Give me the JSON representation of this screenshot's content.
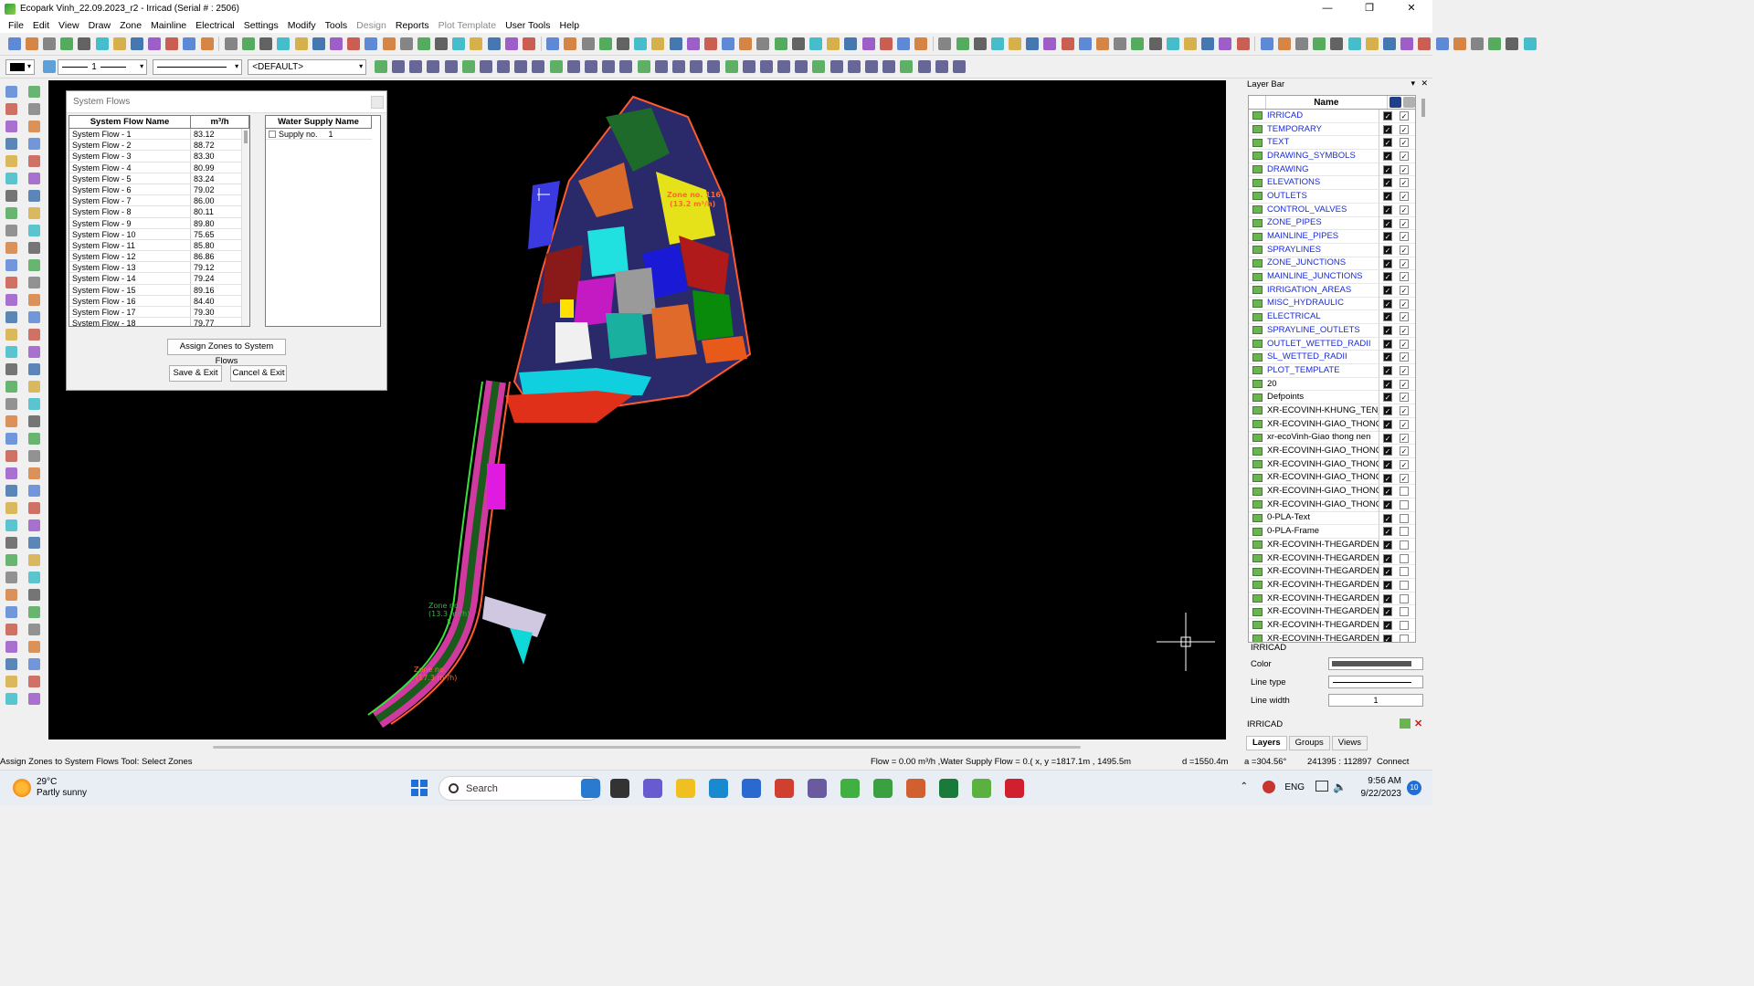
{
  "window": {
    "title": "Ecopark Vinh_22.09.2023_r2 - Irricad (Serial # : 2506)",
    "controls": [
      "—",
      "❐",
      "✕"
    ]
  },
  "menu": [
    {
      "label": "File",
      "enabled": true
    },
    {
      "label": "Edit",
      "enabled": true
    },
    {
      "label": "View",
      "enabled": true
    },
    {
      "label": "Draw",
      "enabled": true
    },
    {
      "label": "Zone",
      "enabled": true
    },
    {
      "label": "Mainline",
      "enabled": true
    },
    {
      "label": "Electrical",
      "enabled": true
    },
    {
      "label": "Settings",
      "enabled": true
    },
    {
      "label": "Modify",
      "enabled": true
    },
    {
      "label": "Tools",
      "enabled": true
    },
    {
      "label": "Design",
      "enabled": false
    },
    {
      "label": "Reports",
      "enabled": true
    },
    {
      "label": "Plot Template",
      "enabled": false
    },
    {
      "label": "User Tools",
      "enabled": true
    },
    {
      "label": "Help",
      "enabled": true
    }
  ],
  "toolbar2": {
    "line_width_value": "1",
    "linetype_value": "",
    "style_value": "<DEFAULT>"
  },
  "dialog": {
    "title": "System Flows",
    "col_name": "System Flow Name",
    "col_flow": "m³/h",
    "col_supply": "Water Supply Name",
    "flows": [
      {
        "name": "System Flow - 1",
        "value": "83.12"
      },
      {
        "name": "System Flow - 2",
        "value": "88.72"
      },
      {
        "name": "System Flow - 3",
        "value": "83.30"
      },
      {
        "name": "System Flow - 4",
        "value": "80.99"
      },
      {
        "name": "System Flow - 5",
        "value": "83.24"
      },
      {
        "name": "System Flow - 6",
        "value": "79.02"
      },
      {
        "name": "System Flow - 7",
        "value": "86.00"
      },
      {
        "name": "System Flow - 8",
        "value": "80.11"
      },
      {
        "name": "System Flow - 9",
        "value": "89.80"
      },
      {
        "name": "System Flow - 10",
        "value": "75.65"
      },
      {
        "name": "System Flow - 11",
        "value": "85.80"
      },
      {
        "name": "System Flow - 12",
        "value": "86.86"
      },
      {
        "name": "System Flow - 13",
        "value": "79.12"
      },
      {
        "name": "System Flow - 14",
        "value": "79.24"
      },
      {
        "name": "System Flow - 15",
        "value": "89.16"
      },
      {
        "name": "System Flow - 16",
        "value": "84.40"
      },
      {
        "name": "System Flow - 17",
        "value": "79.30"
      },
      {
        "name": "System Flow - 18",
        "value": "79.77"
      }
    ],
    "supply": {
      "name": "Supply no.",
      "number": "1"
    },
    "assign_button": "Assign Zones to System Flows",
    "save_button": "Save & Exit",
    "cancel_button": "Cancel & Exit"
  },
  "canvas": {
    "labels": [
      {
        "text": "Zone no. 116",
        "color": "#ff6a2a"
      },
      {
        "text": "(13.2 m³/h)",
        "color": "#ff6a2a"
      },
      {
        "text": "Zone no.",
        "color": "#3fae4a"
      },
      {
        "text": "(13.3 m³/h)",
        "color": "#3fae4a"
      },
      {
        "text": "5",
        "color": "#3fae4a"
      },
      {
        "text": "Zone no.",
        "color": "#ff6a2a"
      },
      {
        "text": "(17.3 m³/h)",
        "color": "#ff6a2a"
      }
    ]
  },
  "layerbar": {
    "title": "Layer Bar",
    "col_name": "Name",
    "layers": [
      {
        "name": "IRRICAD",
        "blue": true,
        "visible": true,
        "printable": true
      },
      {
        "name": "TEMPORARY",
        "blue": true,
        "visible": true,
        "printable": true
      },
      {
        "name": "TEXT",
        "blue": true,
        "visible": true,
        "printable": true
      },
      {
        "name": "DRAWING_SYMBOLS",
        "blue": true,
        "visible": true,
        "printable": true
      },
      {
        "name": "DRAWING",
        "blue": true,
        "visible": true,
        "printable": true
      },
      {
        "name": "ELEVATIONS",
        "blue": true,
        "visible": true,
        "printable": true
      },
      {
        "name": "OUTLETS",
        "blue": true,
        "visible": true,
        "printable": true
      },
      {
        "name": "CONTROL_VALVES",
        "blue": true,
        "visible": true,
        "printable": true
      },
      {
        "name": "ZONE_PIPES",
        "blue": true,
        "visible": true,
        "printable": true
      },
      {
        "name": "MAINLINE_PIPES",
        "blue": true,
        "visible": true,
        "printable": true
      },
      {
        "name": "SPRAYLINES",
        "blue": true,
        "visible": true,
        "printable": true
      },
      {
        "name": "ZONE_JUNCTIONS",
        "blue": true,
        "visible": true,
        "printable": true
      },
      {
        "name": "MAINLINE_JUNCTIONS",
        "blue": true,
        "visible": true,
        "printable": true
      },
      {
        "name": "IRRIGATION_AREAS",
        "blue": true,
        "visible": true,
        "printable": true
      },
      {
        "name": "MISC_HYDRAULIC",
        "blue": true,
        "visible": true,
        "printable": true
      },
      {
        "name": "ELECTRICAL",
        "blue": true,
        "visible": true,
        "printable": true
      },
      {
        "name": "SPRAYLINE_OUTLETS",
        "blue": true,
        "visible": true,
        "printable": true
      },
      {
        "name": "OUTLET_WETTED_RADII",
        "blue": true,
        "visible": true,
        "printable": true
      },
      {
        "name": "SL_WETTED_RADII",
        "blue": true,
        "visible": true,
        "printable": true
      },
      {
        "name": "PLOT_TEMPLATE",
        "blue": true,
        "visible": true,
        "printable": true
      },
      {
        "name": "20",
        "blue": false,
        "visible": true,
        "printable": true
      },
      {
        "name": "Defpoints",
        "blue": false,
        "visible": true,
        "printable": true
      },
      {
        "name": "XR-ECOVINH-KHUNG_TEN_A",
        "blue": false,
        "visible": true,
        "printable": true
      },
      {
        "name": "XR-ECOVINH-GIAO_THONG_",
        "blue": false,
        "visible": true,
        "printable": true
      },
      {
        "name": "xr-ecoVinh-Giao thong nen",
        "blue": false,
        "visible": true,
        "printable": true
      },
      {
        "name": "XR-ECOVINH-GIAO_THONG_",
        "blue": false,
        "visible": true,
        "printable": true
      },
      {
        "name": "XR-ECOVINH-GIAO_THONG_",
        "blue": false,
        "visible": true,
        "printable": true
      },
      {
        "name": "XR-ECOVINH-GIAO_THONG_",
        "blue": false,
        "visible": true,
        "printable": true
      },
      {
        "name": "XR-ECOVINH-GIAO_THONG_",
        "blue": false,
        "visible": true,
        "printable": false
      },
      {
        "name": "XR-ECOVINH-GIAO_THONG_",
        "blue": false,
        "visible": true,
        "printable": false
      },
      {
        "name": "0-PLA-Text",
        "blue": false,
        "visible": true,
        "printable": false
      },
      {
        "name": "0-PLA-Frame",
        "blue": false,
        "visible": true,
        "printable": false
      },
      {
        "name": "XR-ECOVINH-THEGARDEN-C",
        "blue": false,
        "visible": true,
        "printable": false
      },
      {
        "name": "XR-ECOVINH-THEGARDEN-C",
        "blue": false,
        "visible": true,
        "printable": false
      },
      {
        "name": "XR-ECOVINH-THEGARDEN-C",
        "blue": false,
        "visible": true,
        "printable": false
      },
      {
        "name": "XR-ECOVINH-THEGARDEN-C",
        "blue": false,
        "visible": true,
        "printable": false
      },
      {
        "name": "XR-ECOVINH-THEGARDEN-C",
        "blue": false,
        "visible": true,
        "printable": false
      },
      {
        "name": "XR-ECOVINH-THEGARDEN-C",
        "blue": false,
        "visible": true,
        "printable": false
      },
      {
        "name": "XR-ECOVINH-THEGARDEN-C",
        "blue": false,
        "visible": true,
        "printable": false
      },
      {
        "name": "XR-ECOVINH-THEGARDEN-C",
        "blue": false,
        "visible": true,
        "printable": false
      }
    ],
    "selected_layer": "IRRICAD",
    "color_label": "Color",
    "linetype_label": "Line type",
    "linewidth_label": "Line width",
    "linewidth_value": "1",
    "current_layer": "IRRICAD",
    "tabs": [
      "Layers",
      "Groups",
      "Views"
    ]
  },
  "status": {
    "tool": "Assign Zones to System Flows Tool: Select Zones",
    "flow": "Flow = 0.00 m³/h ,Water Supply Flow = 0.( x, y =1817.1m , 1495.5m",
    "distance": "d =1550.4m",
    "angle": "a =304.56°",
    "coords": "241395 : 112897",
    "connect": "Connect"
  },
  "taskbar": {
    "temp": "29°C",
    "weather": "Partly sunny",
    "search": "Search",
    "lang": "ENG",
    "time": "9:56 AM",
    "date": "9/22/2023",
    "notif": "10"
  }
}
